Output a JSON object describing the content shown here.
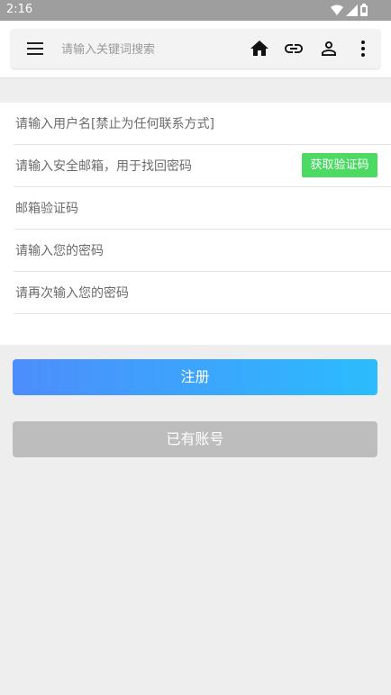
{
  "status_bar": {
    "time": "2:16"
  },
  "search": {
    "placeholder": "请输入关键词搜索"
  },
  "form": {
    "username_placeholder": "请输入用户名[禁止为任何联系方式]",
    "email_placeholder": "请输入安全邮箱，用于找回密码",
    "get_code_label": "获取验证码",
    "code_placeholder": "邮箱验证码",
    "password_placeholder": "请输入您的密码",
    "confirm_placeholder": "请再次输入您的密码"
  },
  "buttons": {
    "register": "注册",
    "have_account": "已有账号"
  },
  "colors": {
    "code_button": "#4cd964",
    "register_start": "#4d8dfc",
    "register_end": "#2bbcfd",
    "have_account": "#bdbdbd"
  },
  "icons": [
    "menu-icon",
    "home-icon",
    "link-icon",
    "person-icon",
    "more-vert-icon",
    "wifi-icon",
    "signal-icon",
    "battery-icon"
  ]
}
